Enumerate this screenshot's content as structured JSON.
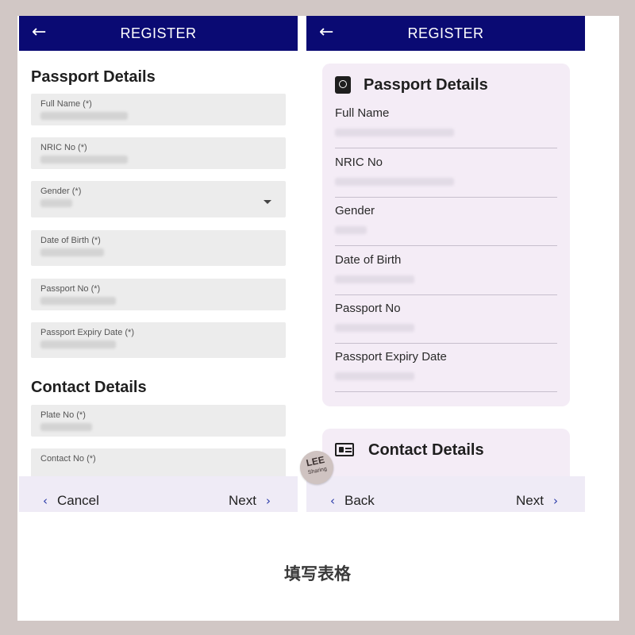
{
  "screen_left": {
    "appbar": {
      "title": "REGISTER",
      "back_icon": "←"
    },
    "passport_section_title": "Passport Details",
    "fields": {
      "full_name": "Full Name (*)",
      "nric": "NRIC No (*)",
      "gender": "Gender (*)",
      "dob": "Date of Birth (*)",
      "passport_no": "Passport No (*)",
      "passport_expiry": "Passport Expiry Date (*)"
    },
    "contact_section_title": "Contact Details",
    "contact_fields": {
      "plate_no": "Plate No (*)",
      "contact_no": "Contact No (*)"
    },
    "bottom": {
      "left": "Cancel",
      "right": "Next",
      "prev_icon": "‹",
      "next_icon": "›"
    }
  },
  "screen_right": {
    "appbar": {
      "title": "REGISTER",
      "back_icon": "←"
    },
    "passport_section_title": "Passport Details",
    "fields": {
      "full_name": "Full Name",
      "nric": "NRIC No",
      "gender": "Gender",
      "dob": "Date of Birth",
      "passport_no": "Passport No",
      "passport_expiry": "Passport Expiry Date"
    },
    "contact_section_title": "Contact Details",
    "bottom": {
      "left": "Back",
      "right": "Next",
      "prev_icon": "‹",
      "next_icon": "›"
    }
  },
  "badge": {
    "line1": "LEE",
    "line2": "Sharing"
  },
  "caption": "填写表格",
  "colors": {
    "appbar": "#0a0a73",
    "panel": "#f4ecf6",
    "bottombar": "#efebf6",
    "chevron": "#2a3aa8"
  }
}
